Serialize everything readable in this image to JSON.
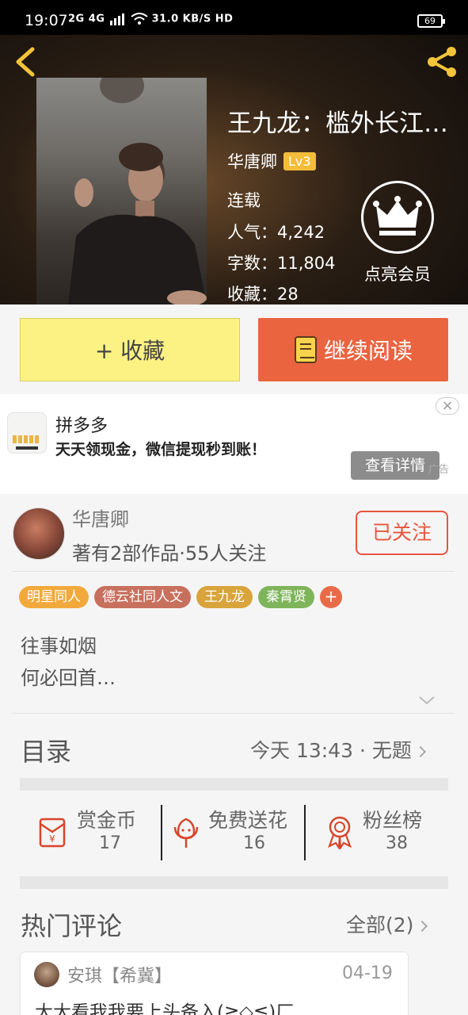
{
  "status_bar": {
    "time": "19:07",
    "net": "2G 4G",
    "speed": "31.0 KB/S",
    "hd": "HD",
    "battery": "69"
  },
  "book": {
    "title": "王九龙：槛外长江…",
    "author": "华唐卿",
    "level": "Lv3",
    "status": "连载",
    "popularity_label": "人气：",
    "popularity": "4,242",
    "words_label": "字数：",
    "words": "11,804",
    "favorites_label": "收藏：",
    "favorites": "28",
    "vip_label": "点亮会员"
  },
  "actions": {
    "collect": "+ 收藏",
    "read": "继续阅读"
  },
  "ad": {
    "title": "拼多多",
    "description": "天天领现金，微信提现秒到账！",
    "detail_button": "查看详情",
    "mark": "广告",
    "close": "×"
  },
  "author_card": {
    "name": "华唐卿",
    "stats": "著有2部作品·55人关注",
    "follow": "已关注",
    "tags": [
      {
        "label": "明星同人",
        "color": "#f2a93c"
      },
      {
        "label": "德云社同人文",
        "color": "#c8705e"
      },
      {
        "label": "王九龙",
        "color": "#d9a43b"
      },
      {
        "label": "秦霄贤",
        "color": "#7fb55a"
      }
    ],
    "intro": [
      "往事如烟",
      "何必回首…"
    ]
  },
  "toc": {
    "title": "目录",
    "latest": "今天 13:43 · 无题"
  },
  "stats": [
    {
      "label": "赏金币",
      "value": "17",
      "icon": "red-envelope-icon"
    },
    {
      "label": "免费送花",
      "value": "16",
      "icon": "flower-icon"
    },
    {
      "label": "粉丝榜",
      "value": "38",
      "icon": "medal-icon"
    }
  ],
  "hot_comments": {
    "title": "热门评论",
    "all": "全部(2)",
    "items": [
      {
        "user": "安琪【希冀】",
        "date": "04-19",
        "text": "大大看我我要上头备入(≧◇≦)厂"
      }
    ]
  },
  "colors": {
    "accent": "#ea6440",
    "collect_bg": "#fbf283",
    "badge": "#f3bd3a"
  }
}
